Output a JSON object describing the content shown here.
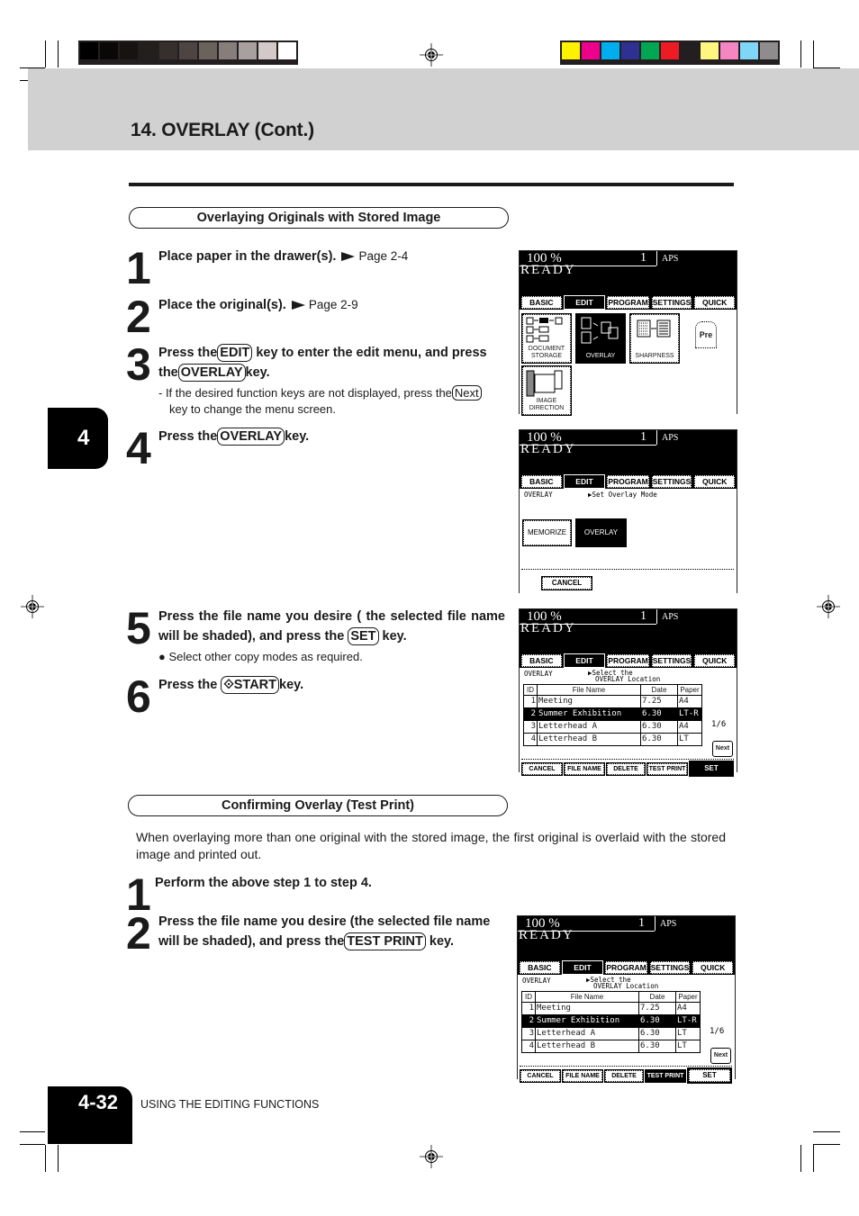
{
  "print_marks": {
    "gray_swatches": [
      "#000000",
      "#0a0806",
      "#171311",
      "#231f1c",
      "#372f2c",
      "#4e4442",
      "#6b615d",
      "#877e7b",
      "#a8a09e",
      "#d3c9c8",
      "#ffffff"
    ],
    "color_swatches": [
      "#fff200",
      "#ec008c",
      "#00aeef",
      "#2e3192",
      "#00a651",
      "#ed1c24",
      "#231f20",
      "#fff67f",
      "#f685c4",
      "#7fd6f7",
      "#8e8c8c"
    ]
  },
  "header": {
    "title": "14. OVERLAY (Cont.)"
  },
  "chapter_tab": "4",
  "section1": {
    "title": "Overlaying Originals with Stored Image",
    "steps": [
      {
        "num": "1",
        "text": "Place paper in the drawer(s).",
        "ref": "Page 2-4"
      },
      {
        "num": "2",
        "text": "Place the original(s).",
        "ref": "Page 2-9"
      },
      {
        "num": "3",
        "pre": "Press the",
        "key1": "EDIT",
        "mid": "key to enter the edit menu, and press the",
        "key2": "OVERLAY",
        "post": "key.",
        "note_pre": "- If the desired function keys are not displayed, press the",
        "note_key": "Next",
        "note_post": "key to change the menu screen."
      },
      {
        "num": "4",
        "pre": "Press the",
        "key": "OVERLAY",
        "post": "key."
      },
      {
        "num": "5",
        "pre": "Press the file name you desire ( the selected file name will be shaded), and press the",
        "key": "SET",
        "post": "key.",
        "bullet": "Select other copy modes as required."
      },
      {
        "num": "6",
        "pre": "Press the",
        "key": "⟐START",
        "post": "key."
      }
    ]
  },
  "section2": {
    "title": "Confirming Overlay (Test Print)",
    "paragraph": "When overlaying more than one original with the stored image, the first original is overlaid with the stored image and printed out.",
    "steps": [
      {
        "num": "1",
        "text": "Perform the above step 1 to step 4."
      },
      {
        "num": "2",
        "pre": "Press the file name you desire (the selected file name will be shaded), and press the",
        "key": "TEST PRINT",
        "post": "key."
      }
    ]
  },
  "lcd": {
    "zoom": "100  %",
    "copies": "1",
    "paper_mode": "APS",
    "status": "READY",
    "tabs": [
      "BASIC",
      "EDIT",
      "PROGRAM",
      "SETTINGS",
      "QUICK"
    ],
    "active_tab": "EDIT",
    "screen1": {
      "icons": [
        "DOCUMENT STORAGE",
        "OVERLAY",
        "SHARPNESS",
        "IMAGE DIRECTION"
      ],
      "pre_label": "Pre"
    },
    "screen2": {
      "mode_label": "OVERLAY",
      "prompt": "▶Set Overlay Mode",
      "buttons": [
        "MEMORIZE",
        "OVERLAY"
      ],
      "cancel": "CANCEL"
    },
    "file_screen": {
      "mode_label": "OVERLAY",
      "prompt_line1": "▶Select the",
      "prompt_line2": "OVERLAY Location",
      "columns": [
        "ID",
        "File Name",
        "Date",
        "Paper"
      ],
      "rows_a": [
        {
          "id": "1",
          "name": "Meeting",
          "date": "7.25",
          "paper": "A4"
        },
        {
          "id": "2",
          "name": "Summer Exhibition",
          "date": "6.30",
          "paper": "LT-R"
        },
        {
          "id": "3",
          "name": "Letterhead A",
          "date": "6.30",
          "paper": "A4"
        },
        {
          "id": "4",
          "name": "Letterhead B",
          "date": "6.30",
          "paper": "LT"
        }
      ],
      "rows_b": [
        {
          "id": "1",
          "name": "Meeting",
          "date": "7.25",
          "paper": "A4"
        },
        {
          "id": "2",
          "name": "Summer Exhibition",
          "date": "6.30",
          "paper": "LT-R"
        },
        {
          "id": "3",
          "name": "Letterhead A",
          "date": "6.30",
          "paper": "LT"
        },
        {
          "id": "4",
          "name": "Letterhead B",
          "date": "6.30",
          "paper": "LT"
        }
      ],
      "selected_id": "2",
      "page": "1/6",
      "next": "Next",
      "buttons": [
        "CANCEL",
        "FILE NAME",
        "DELETE",
        "TEST PRINT",
        "SET"
      ]
    }
  },
  "footer": {
    "page_number": "4-32",
    "section": "USING THE EDITING FUNCTIONS"
  }
}
